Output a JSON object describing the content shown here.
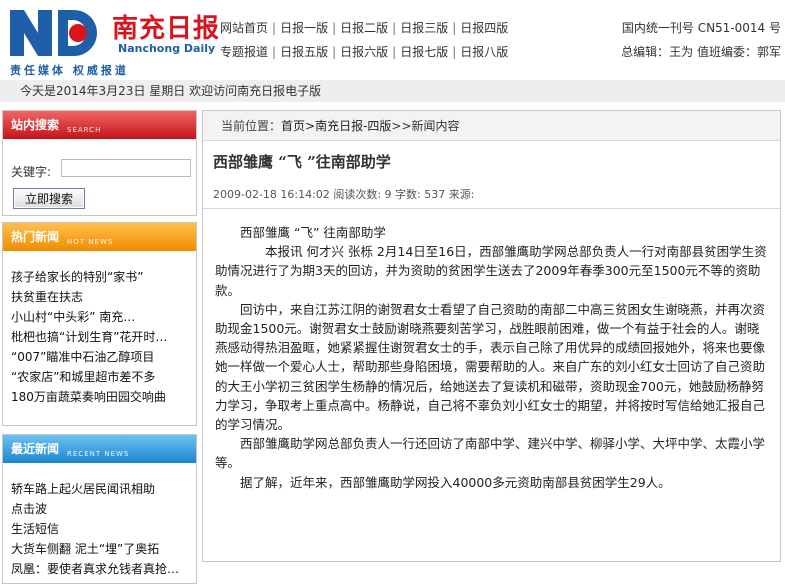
{
  "header": {
    "logo": {
      "cn_name": "南充日报",
      "en_name": "Nanchong Daily",
      "slogan": "责任媒体  权威报道"
    },
    "nav_row1": [
      "网站首页",
      "日报一版",
      "日报二版",
      "日报三版",
      "日报四版"
    ],
    "nav_row2": [
      "专题报道",
      "日报五版",
      "日报六版",
      "日报七版",
      "日报八版"
    ],
    "issn": "国内统一刊号  CN51-0014 号",
    "editors": "总编辑：王为  值班编委：郭军"
  },
  "datebar": {
    "text": "今天是2014年3月23日 星期日  欢迎访问南充日报电子版"
  },
  "sidebar": {
    "search": {
      "title": "站内搜索",
      "title_en": "SEARCH",
      "keyword_label": "关键字:",
      "input_value": "",
      "button_label": "立即搜索"
    },
    "hot": {
      "title": "热门新闻",
      "title_en": "HOT NEWS",
      "items": [
        "孩子给家长的特别“家书”",
        "扶贫重在扶志",
        "小山村“中头彩” 南充…",
        "枇杷也搞“计划生育”花开时…",
        "“007”瞄准中石油乙醇项目",
        "“农家店”和城里超市差不多",
        "180万亩蔬菜奏响田园交响曲"
      ]
    },
    "recent": {
      "title": "最近新闻",
      "title_en": "RECENT NEWS",
      "items": [
        "轿车路上起火居民闻讯相助",
        "点击波",
        "生活短信",
        "大货车侧翻  泥土“埋”了奥拓",
        "凤凰：要使者真求允钱者真抢…"
      ]
    }
  },
  "main": {
    "breadcrumb": {
      "prefix": "当前位置：",
      "path": "首页>南充日报-四版",
      "suffix": ">>新闻内容"
    },
    "title": "西部雏鹰 “飞 ”往南部助学",
    "meta": "2009-02-18 16:14:02 阅读次数: 9 字数: 537 来源:",
    "paragraphs": [
      "西部雏鹰 “飞” 往南部助学",
      "本报讯  何才兴  张栎  2月14日至16日，西部雏鹰助学网总部负责人一行对南部县贫困学生资助情况进行了为期3天的回访，并为资助的贫困学生送去了2009年春季300元至1500元不等的资助款。",
      "回访中，来自江苏江阴的谢贺君女士看望了自己资助的南部二中高三贫困女生谢晓燕，并再次资助现金1500元。谢贺君女士鼓励谢晓燕要刻苦学习，战胜眼前困难，做一个有益于社会的人。谢晓燕感动得热泪盈眶，她紧紧握住谢贺君女士的手，表示自己除了用优异的成绩回报她外，将来也要像她一样做一个爱心人士，帮助那些身陷困境，需要帮助的人。来自广东的刘小红女士回访了自己资助的大王小学初三贫困学生杨静的情况后，给她送去了复读机和磁带，资助现金700元，她鼓励杨静努力学习，争取考上重点高中。杨静说，自己将不辜负刘小红女士的期望，并将按时写信给她汇报自己的学习情况。",
      "西部雏鹰助学网总部负责人一行还回访了南部中学、建兴中学、柳驿小学、大坪中学、太霞小学等。",
      "据了解，近年来，西部雏鹰助学网投入40000多元资助南部县贫困学生29人。"
    ]
  },
  "colors": {
    "brand_red": "#d7151f",
    "brand_blue": "#1f5fa8",
    "hot_orange": "#f08b00",
    "recent_blue": "#1b86cf"
  }
}
